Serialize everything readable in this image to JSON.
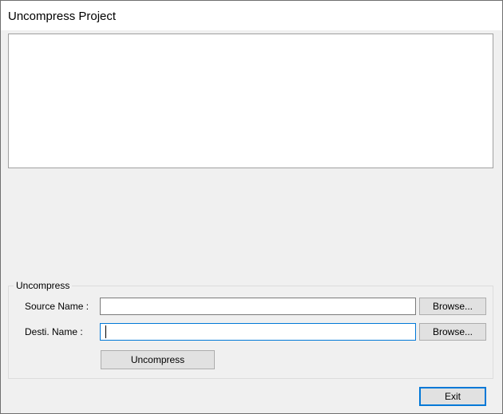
{
  "window": {
    "title": "Uncompress Project"
  },
  "uncompress_group": {
    "title": "Uncompress",
    "source": {
      "label": "Source Name :",
      "value": "",
      "browse_label": "Browse..."
    },
    "destination": {
      "label": "Desti. Name :",
      "value": "",
      "browse_label": "Browse..."
    },
    "uncompress_label": "Uncompress"
  },
  "footer": {
    "exit_label": "Exit"
  },
  "colors": {
    "focus_border": "#0078d7",
    "dialog_background": "#f0f0f0"
  }
}
